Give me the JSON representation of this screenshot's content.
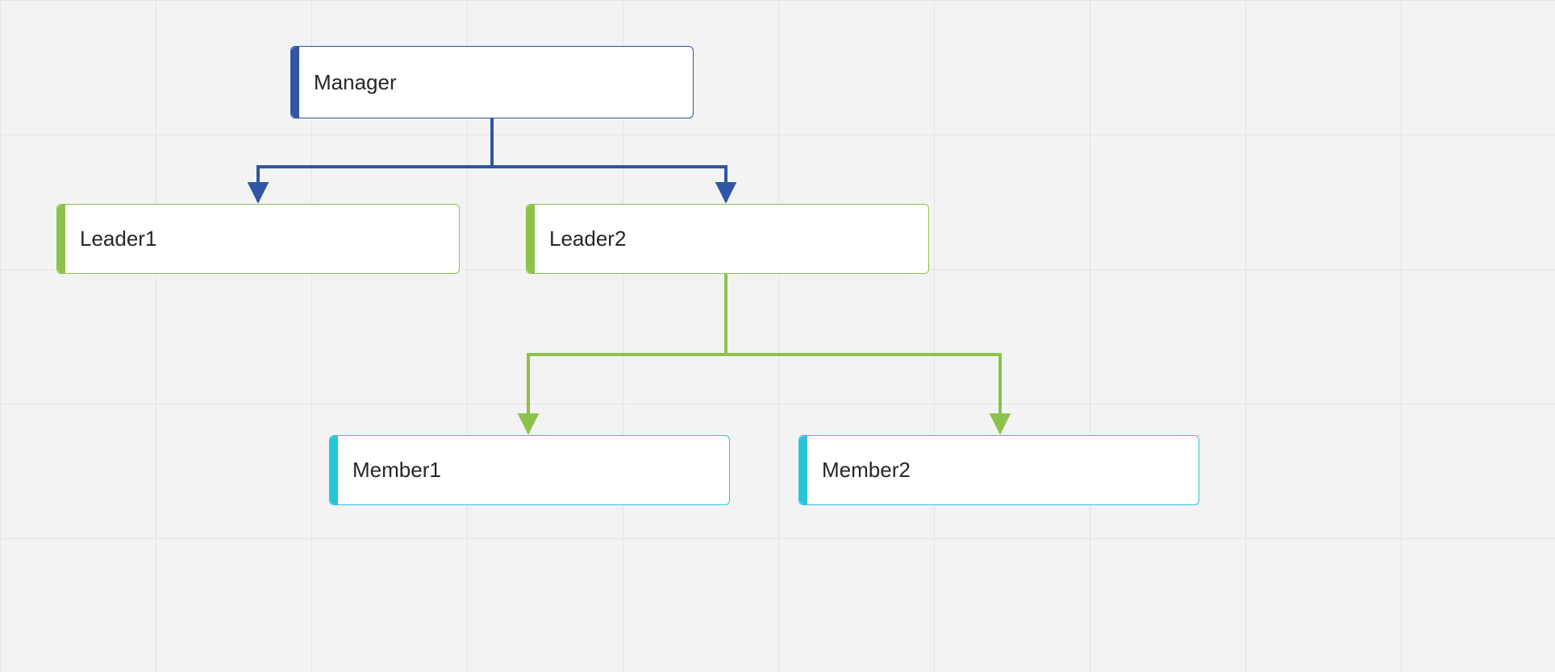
{
  "diagram": {
    "type": "org-chart",
    "colors": {
      "level0": "#2f55a4",
      "level1": "#8bc34a",
      "level2": "#26c6da",
      "grid": "#e4e4e4",
      "background": "#f3f3f3"
    },
    "nodes": {
      "manager": {
        "label": "Manager",
        "level": 0
      },
      "leader1": {
        "label": "Leader1",
        "level": 1
      },
      "leader2": {
        "label": "Leader2",
        "level": 1
      },
      "member1": {
        "label": "Member1",
        "level": 2
      },
      "member2": {
        "label": "Member2",
        "level": 2
      }
    },
    "edges": [
      {
        "from": "manager",
        "to": "leader1",
        "color": "#2f55a4"
      },
      {
        "from": "manager",
        "to": "leader2",
        "color": "#2f55a4"
      },
      {
        "from": "leader2",
        "to": "member1",
        "color": "#8bc34a"
      },
      {
        "from": "leader2",
        "to": "member2",
        "color": "#8bc34a"
      }
    ]
  }
}
